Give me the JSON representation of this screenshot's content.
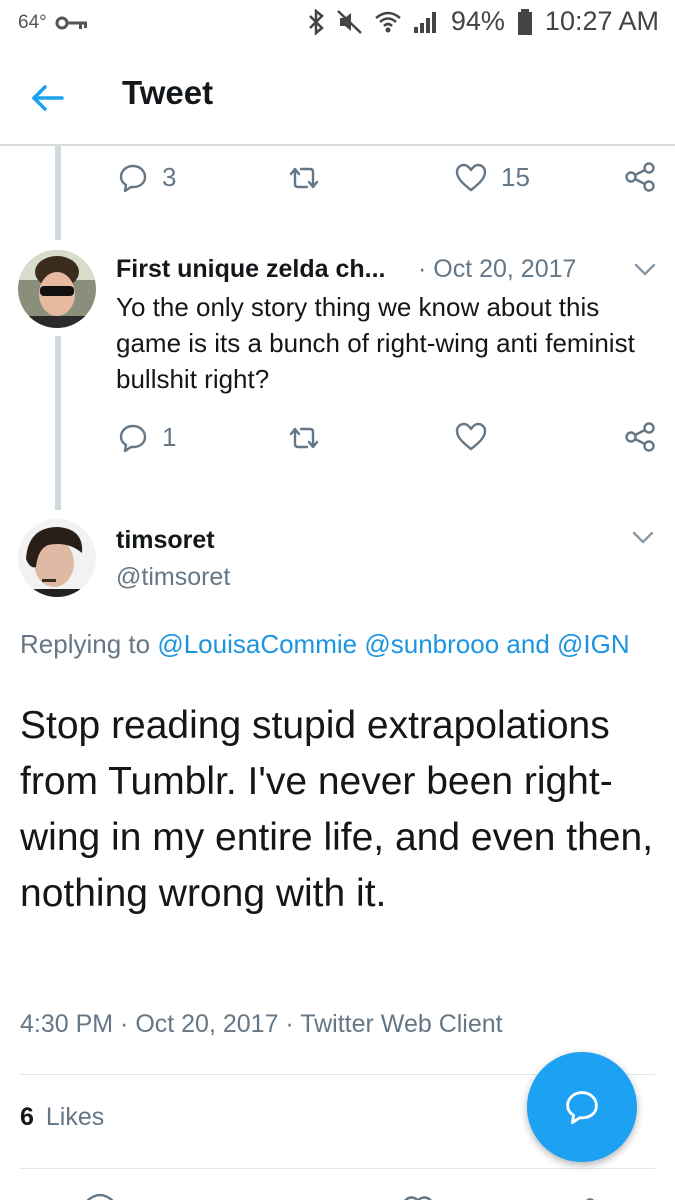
{
  "status_bar": {
    "temperature": "64°",
    "battery": "94%",
    "time": "10:27 AM"
  },
  "header": {
    "title": "Tweet"
  },
  "prev_actions": {
    "replies": "3",
    "retweets": "",
    "likes": "15"
  },
  "reply_tweet": {
    "name": "First unique zelda ch...",
    "date": "· Oct 20, 2017",
    "text": "Yo the only story thing we know about this game is its a bunch of right-wing anti feminist bullshit right?",
    "replies": "1",
    "retweets": "",
    "likes": ""
  },
  "main_tweet": {
    "name": "timsoret",
    "handle": "@timsoret",
    "replying_label": "Replying to ",
    "mention_1": "@LouisaCommie",
    "mention_2": "@sunbrooo",
    "and": " and ",
    "mention_3": "@IGN",
    "text": "Stop reading stupid extrapolations from Tumblr. I've never been right-wing in my entire life, and even then, nothing wrong with it.",
    "timestamp": "4:30 PM · Oct 20, 2017 · Twitter Web Client",
    "likes_count": "6",
    "likes_label": "Likes"
  },
  "colors": {
    "accent": "#1da1f2",
    "link": "#1b95e0",
    "muted": "#657786",
    "thread_line": "#cfd9de"
  }
}
